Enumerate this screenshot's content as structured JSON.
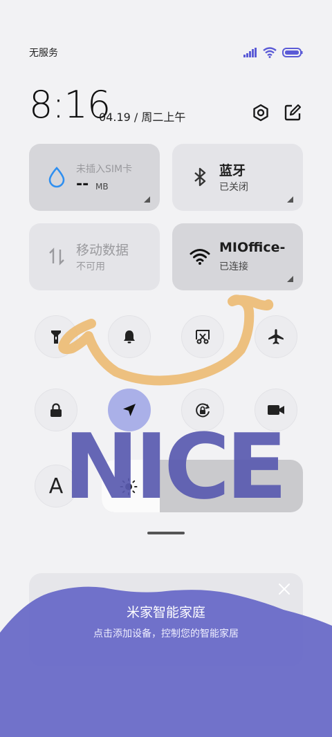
{
  "status_bar": {
    "carrier": "无服务"
  },
  "header": {
    "time": "8:16",
    "date": "04.19 / 周二上午"
  },
  "tiles": [
    {
      "title": "未插入SIM卡",
      "value": "--",
      "unit": "MB"
    },
    {
      "title": "蓝牙",
      "sub": "已关闭"
    },
    {
      "title": "移动数据",
      "sub": "不可用"
    },
    {
      "title": "MIOffice-",
      "sub": "已连接"
    }
  ],
  "toggles": [
    {
      "name": "flashlight-icon"
    },
    {
      "name": "bell-icon"
    },
    {
      "name": "screenshot-icon"
    },
    {
      "name": "airplane-icon"
    },
    {
      "name": "lock-icon"
    },
    {
      "name": "location-icon",
      "active": true
    },
    {
      "name": "rotation-lock-icon"
    },
    {
      "name": "video-camera-icon"
    },
    {
      "name": "font-size-icon",
      "label": "A"
    }
  ],
  "brightness": {
    "level": 0.29
  },
  "card": {
    "title": "米家智能家庭",
    "subtitle": "点击添加设备，控制您的智能家居"
  },
  "annotations": {
    "text": "NICE"
  },
  "colors": {
    "accent": "#aab0e8",
    "wave": "#6b6cc8",
    "scribble_orange": "#edbc74",
    "scribble_blue": "#5a5bb0"
  }
}
